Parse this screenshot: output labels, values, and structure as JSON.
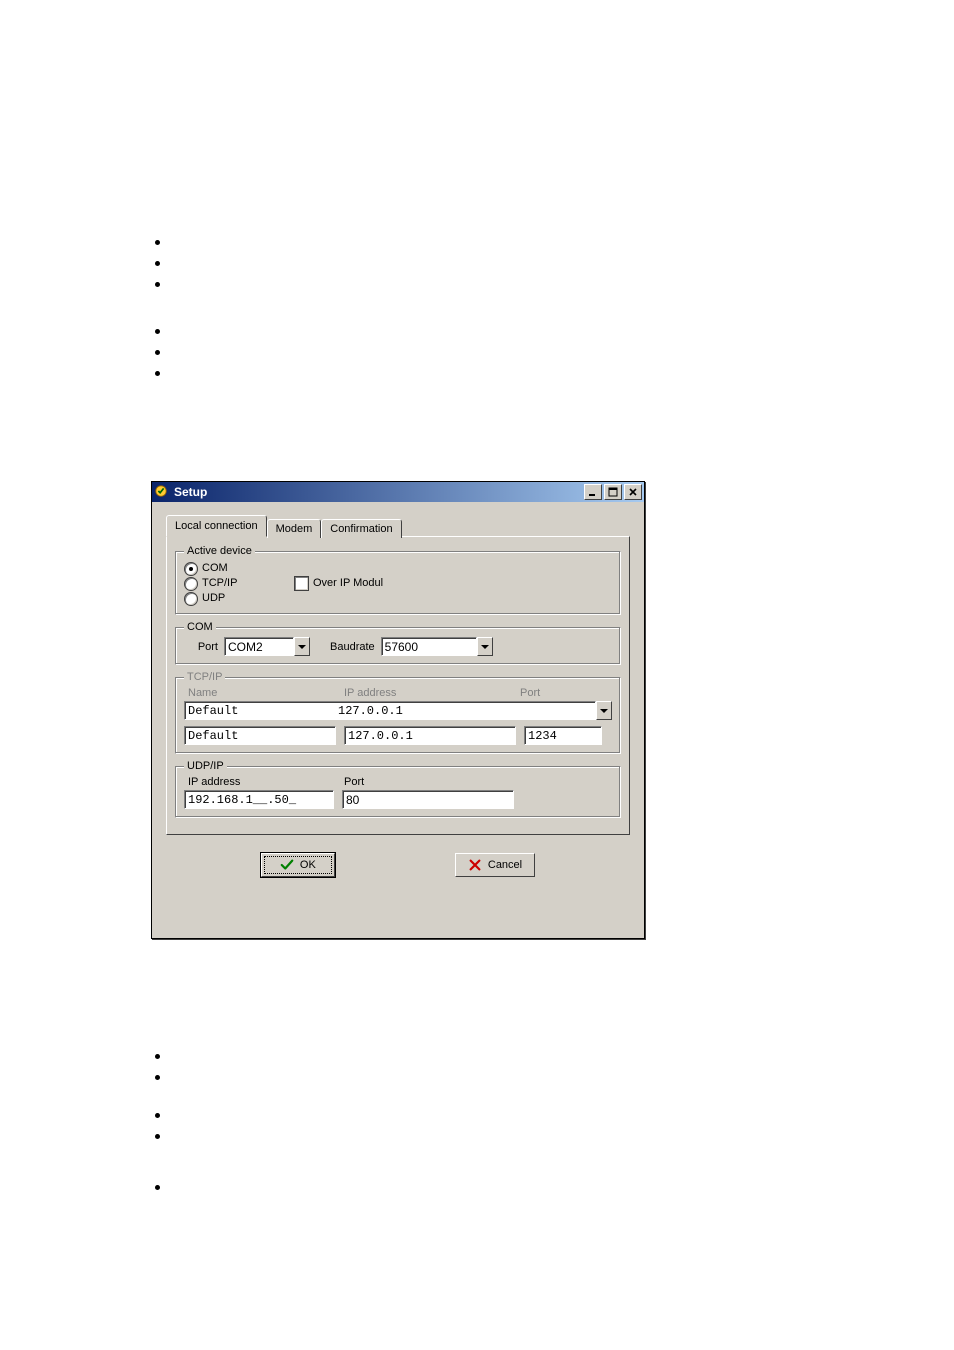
{
  "window": {
    "title": "Setup"
  },
  "tabs": {
    "local": "Local connection",
    "modem": "Modem",
    "confirmation": "Confirmation"
  },
  "groups": {
    "active_device": {
      "legend": "Active device",
      "com": "COM",
      "tcpip": "TCP/IP",
      "udp": "UDP",
      "over_ip": "Over IP Modul",
      "selected": "COM"
    },
    "com": {
      "legend": "COM",
      "port_label": "Port",
      "port_value": "COM2",
      "baud_label": "Baudrate",
      "baud_value": "57600"
    },
    "tcpip": {
      "legend": "TCP/IP",
      "name_label": "Name",
      "ip_label": "IP address",
      "port_label": "Port",
      "preset_name": "Default",
      "preset_ip": "127.0.0.1",
      "name_value": "Default",
      "ip_value": "127.0.0.1",
      "port_value": "1234"
    },
    "udpip": {
      "legend": "UDP/IP",
      "ip_label": "IP address",
      "port_label": "Port",
      "ip_value": "192.168.1__.50_",
      "port_value": "80"
    }
  },
  "buttons": {
    "ok": "OK",
    "cancel": "Cancel"
  }
}
